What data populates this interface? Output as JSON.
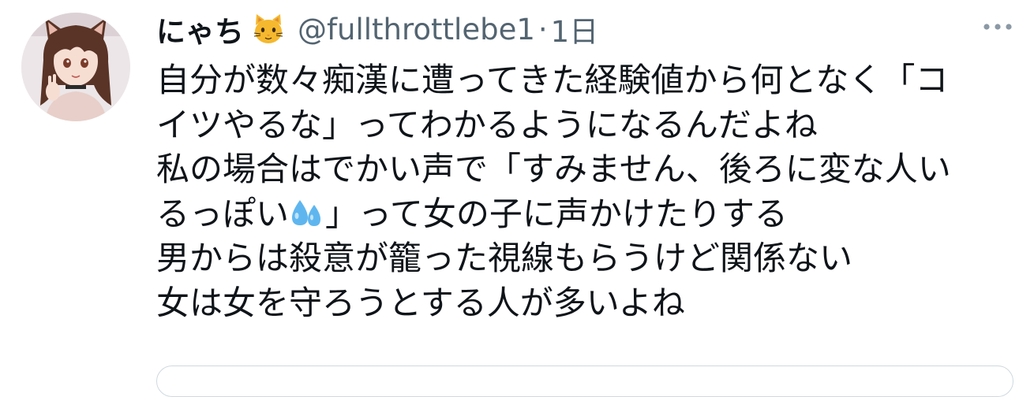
{
  "tweet": {
    "author": {
      "display_name": "にゃち",
      "emoji": "cat-face-emoji",
      "handle": "@fullthrottlebe1",
      "separator": "·",
      "time": "1日"
    },
    "more_icon": "more-horizontal-icon",
    "text": {
      "line1": "自分が数々痴漢に遭ってきた経験値から何となく「コ",
      "line2": "イツやるな」ってわかるようになるんだよね",
      "line3": "私の場合はでかい声で「すみません、後ろに変な人い",
      "line4_before": "るっぽい",
      "line4_emoji": "sweat-droplets-emoji",
      "line4_after": "」って女の子に声かけたりする",
      "line5": "男からは殺意が籠った視線もらうけど関係ない",
      "line6": "女は女を守ろうとする人が多いよね"
    },
    "colors": {
      "text": "#0f1419",
      "secondary": "#536471",
      "border": "#cfd9de",
      "emoji_blue": "#5fb6ef",
      "emoji_yellow": "#f5b82e"
    }
  }
}
